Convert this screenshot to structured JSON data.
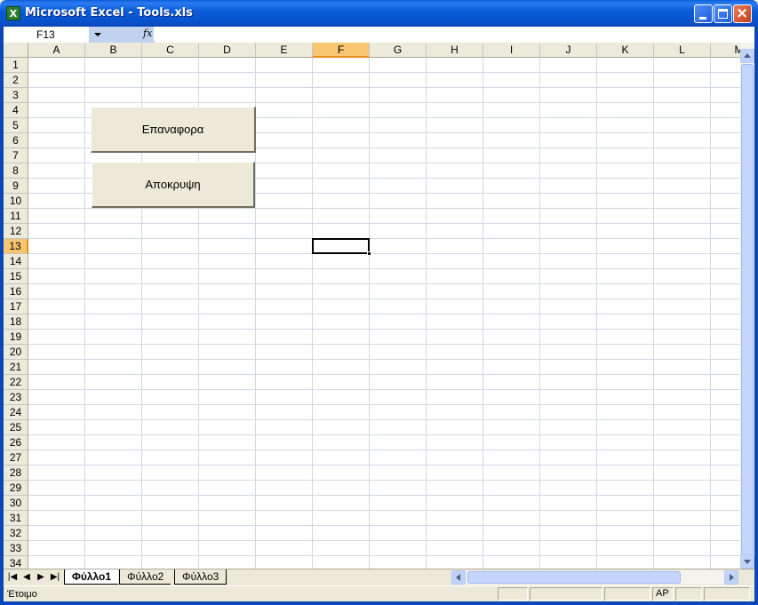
{
  "window": {
    "title": "Microsoft Excel - Tools.xls",
    "app_icon": "excel-icon",
    "app_icon_glyph": "X"
  },
  "formula_bar": {
    "name_box": "F13",
    "fx_label": "fx",
    "formula": ""
  },
  "sheet": {
    "columns": [
      "A",
      "B",
      "C",
      "D",
      "E",
      "F",
      "G",
      "H",
      "I",
      "J",
      "K",
      "L",
      "M"
    ],
    "rows": [
      "1",
      "2",
      "3",
      "4",
      "5",
      "6",
      "7",
      "8",
      "9",
      "10",
      "11",
      "12",
      "13",
      "14",
      "15",
      "16",
      "17",
      "18",
      "19",
      "20",
      "21",
      "22",
      "23",
      "24",
      "25",
      "26",
      "27",
      "28",
      "29",
      "30",
      "31",
      "32",
      "33",
      "34"
    ],
    "selected_column": "F",
    "selected_row": "13",
    "buttons": [
      {
        "label": "Επαναφορα"
      },
      {
        "label": "Αποκρυψη"
      }
    ]
  },
  "tabs": {
    "nav": [
      "|◀",
      "◀",
      "▶",
      "▶|"
    ],
    "sheets": [
      {
        "label": "Φύλλο1",
        "active": true
      },
      {
        "label": "Φύλλο2",
        "active": false
      },
      {
        "label": "Φύλλο3",
        "active": false
      }
    ]
  },
  "status": {
    "ready": "Έτοιμο",
    "caps": "ΑΡ"
  }
}
